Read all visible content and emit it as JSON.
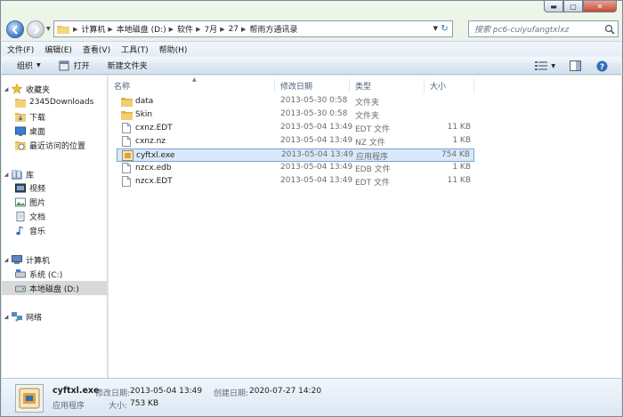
{
  "window": {
    "caption": {
      "minimize": "▬",
      "maximize": "▢",
      "close": "✕"
    }
  },
  "address_bar": {
    "crumbs": [
      "计算机",
      "本地磁盘 (D:)",
      "软件",
      "7月",
      "27",
      "帮雨方通讯录"
    ],
    "search_placeholder": "搜索 pc6-cuiyufangtxlxz"
  },
  "menu": [
    "文件(F)",
    "编辑(E)",
    "查看(V)",
    "工具(T)",
    "帮助(H)"
  ],
  "toolbar": {
    "organize": "组织",
    "open": "打开",
    "new_folder": "新建文件夹"
  },
  "nav": {
    "favorites": "收藏夹",
    "fav_items": [
      "2345Downloads",
      "下载",
      "桌面",
      "最近访问的位置"
    ],
    "libraries": "库",
    "lib_items": [
      "视频",
      "图片",
      "文档",
      "音乐"
    ],
    "computer": "计算机",
    "computer_items": [
      "系统 (C:)",
      "本地磁盘 (D:)"
    ],
    "network": "网络"
  },
  "columns": {
    "name": "名称",
    "date": "修改日期",
    "type": "类型",
    "size": "大小"
  },
  "files": [
    {
      "name": "data",
      "date": "2013-05-30 0:58",
      "type": "文件夹",
      "size": "",
      "icon": "folder-icon"
    },
    {
      "name": "Skin",
      "date": "2013-05-30 0:58",
      "type": "文件夹",
      "size": "",
      "icon": "folder-icon"
    },
    {
      "name": "cxnz.EDT",
      "date": "2013-05-04 13:49",
      "type": "EDT 文件",
      "size": "11 KB",
      "icon": "file-icon"
    },
    {
      "name": "cxnz.nz",
      "date": "2013-05-04 13:49",
      "type": "NZ 文件",
      "size": "1 KB",
      "icon": "file-icon"
    },
    {
      "name": "cyftxl.exe",
      "date": "2013-05-04 13:49",
      "type": "应用程序",
      "size": "754 KB",
      "icon": "exe-icon"
    },
    {
      "name": "nzcx.edb",
      "date": "2013-05-04 13:49",
      "type": "EDB 文件",
      "size": "1 KB",
      "icon": "file-icon"
    },
    {
      "name": "nzcx.EDT",
      "date": "2013-05-04 13:49",
      "type": "EDT 文件",
      "size": "11 KB",
      "icon": "file-icon"
    }
  ],
  "details": {
    "name": "cyftxl.exe",
    "modified_label": "修改日期:",
    "modified": "2013-05-04 13:49",
    "created_label": "创建日期:",
    "created": "2020-07-27 14:20",
    "type": "应用程序",
    "size_label": "大小:",
    "size": "753 KB"
  }
}
